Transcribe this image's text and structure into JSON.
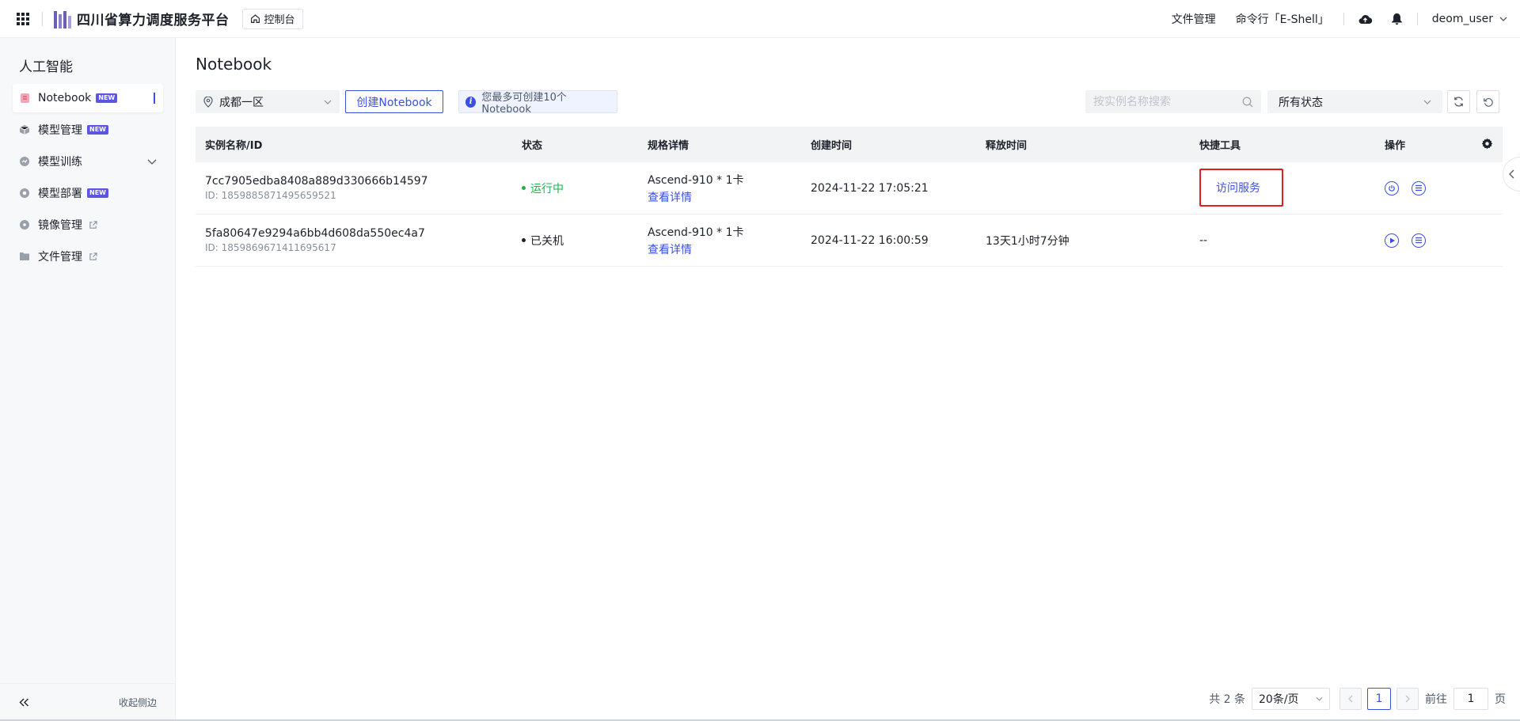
{
  "header": {
    "brand": "四川省算力调度服务平台",
    "console_label": "控制台",
    "links": [
      "文件管理",
      "命令行「E-Shell」"
    ],
    "username": "deom_user"
  },
  "sidebar": {
    "title": "人工智能",
    "items": [
      {
        "label": "Notebook",
        "badge": "NEW",
        "icon": "notebook-icon"
      },
      {
        "label": "模型管理",
        "badge": "NEW",
        "icon": "cube-icon"
      },
      {
        "label": "模型训练",
        "icon": "training-icon"
      },
      {
        "label": "模型部署",
        "badge": "NEW",
        "icon": "deploy-icon"
      },
      {
        "label": "镜像管理",
        "icon": "disc-icon"
      },
      {
        "label": "文件管理",
        "icon": "folder-icon"
      }
    ],
    "collapse_label": "收起侧边"
  },
  "main": {
    "title": "Notebook",
    "region": "成都一区",
    "create_label": "创建Notebook",
    "tip": "您最多可创建10个Notebook",
    "search_placeholder": "按实例名称搜索",
    "status_filter": "所有状态"
  },
  "table": {
    "columns": [
      "实例名称/ID",
      "状态",
      "规格详情",
      "创建时间",
      "释放时间",
      "快捷工具",
      "操作"
    ],
    "rows": [
      {
        "name": "7cc7905edba8408a889d330666b14597",
        "id": "ID: 1859885871495659521",
        "status": "运行中",
        "status_color": "#23b14d",
        "spec": "Ascend-910 * 1卡",
        "spec_link": "查看详情",
        "created": "2024-11-22 17:05:21",
        "release": "",
        "quick": "访问服务"
      },
      {
        "name": "5fa80647e9294a6bb4d608da550ec4a7",
        "id": "ID: 1859869671411695617",
        "status": "已关机",
        "status_color": "#1d2129",
        "spec": "Ascend-910 * 1卡",
        "spec_link": "查看详情",
        "created": "2024-11-22 16:00:59",
        "release": "13天1小时7分钟",
        "quick": "--"
      }
    ]
  },
  "pager": {
    "total": "共 2 条",
    "page_size": "20条/页",
    "current": "1",
    "goto_prefix": "前往",
    "goto_value": "1",
    "goto_suffix": "页"
  },
  "colors": {
    "accent": "#3b50e0",
    "highlight": "#e02020",
    "running": "#23b14d"
  }
}
